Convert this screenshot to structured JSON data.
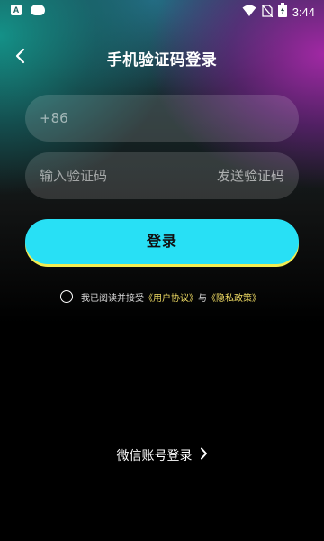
{
  "status_bar": {
    "time": "3:44",
    "battery_level": "2",
    "icons": [
      "a-app-icon",
      "cloud-icon",
      "wifi-icon",
      "no-sim-icon",
      "battery-icon"
    ]
  },
  "header": {
    "title": "手机验证码登录",
    "back_icon": "chevron-left-icon"
  },
  "form": {
    "phone_placeholder": "+86",
    "code_placeholder": "输入验证码",
    "send_code_label": "发送验证码",
    "login_label": "登录"
  },
  "agreement": {
    "prefix": "我已阅读并接受",
    "user_agreement": "《用户协议》",
    "conjunction": "与",
    "privacy_policy": "《隐私政策》"
  },
  "alt_login": {
    "wechat_label": "微信账号登录",
    "arrow_icon": "chevron-right-icon"
  },
  "colors": {
    "accent": "#28e0f5",
    "accent_shadow": "#f2ec52",
    "link": "#f0dc64",
    "background": "#000000"
  }
}
